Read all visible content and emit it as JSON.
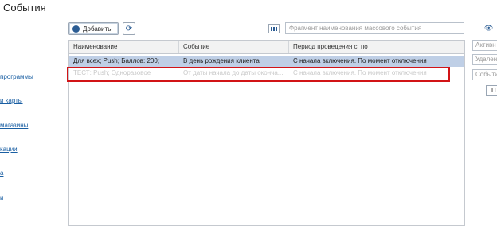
{
  "page_title": "События",
  "nav": [
    "программы",
    "и карты",
    "магазины",
    "кации",
    "а",
    "и"
  ],
  "toolbar": {
    "add_label": "Добавить",
    "search_placeholder": "Фрагмент наименования массового события"
  },
  "table": {
    "columns": [
      "Наименование",
      "Событие",
      "Период проведения с, по"
    ],
    "rows": [
      [
        "Для всех; Push; Баллов: 200;",
        "В день рождения клиента",
        "С начала включения. По момент отключения"
      ],
      [
        "ТЕСТ: Push; Одноразовое",
        "От даты начала до даты оконча...",
        "С начала включения. По момент отключения"
      ]
    ]
  },
  "side_panel": {
    "active": "Активн",
    "deleted": "Удален",
    "events": "Событи",
    "button": "П"
  },
  "colors": {
    "accent": "#2b5c93",
    "selection": "#bfcfe6",
    "highlight_border": "#d21417"
  }
}
